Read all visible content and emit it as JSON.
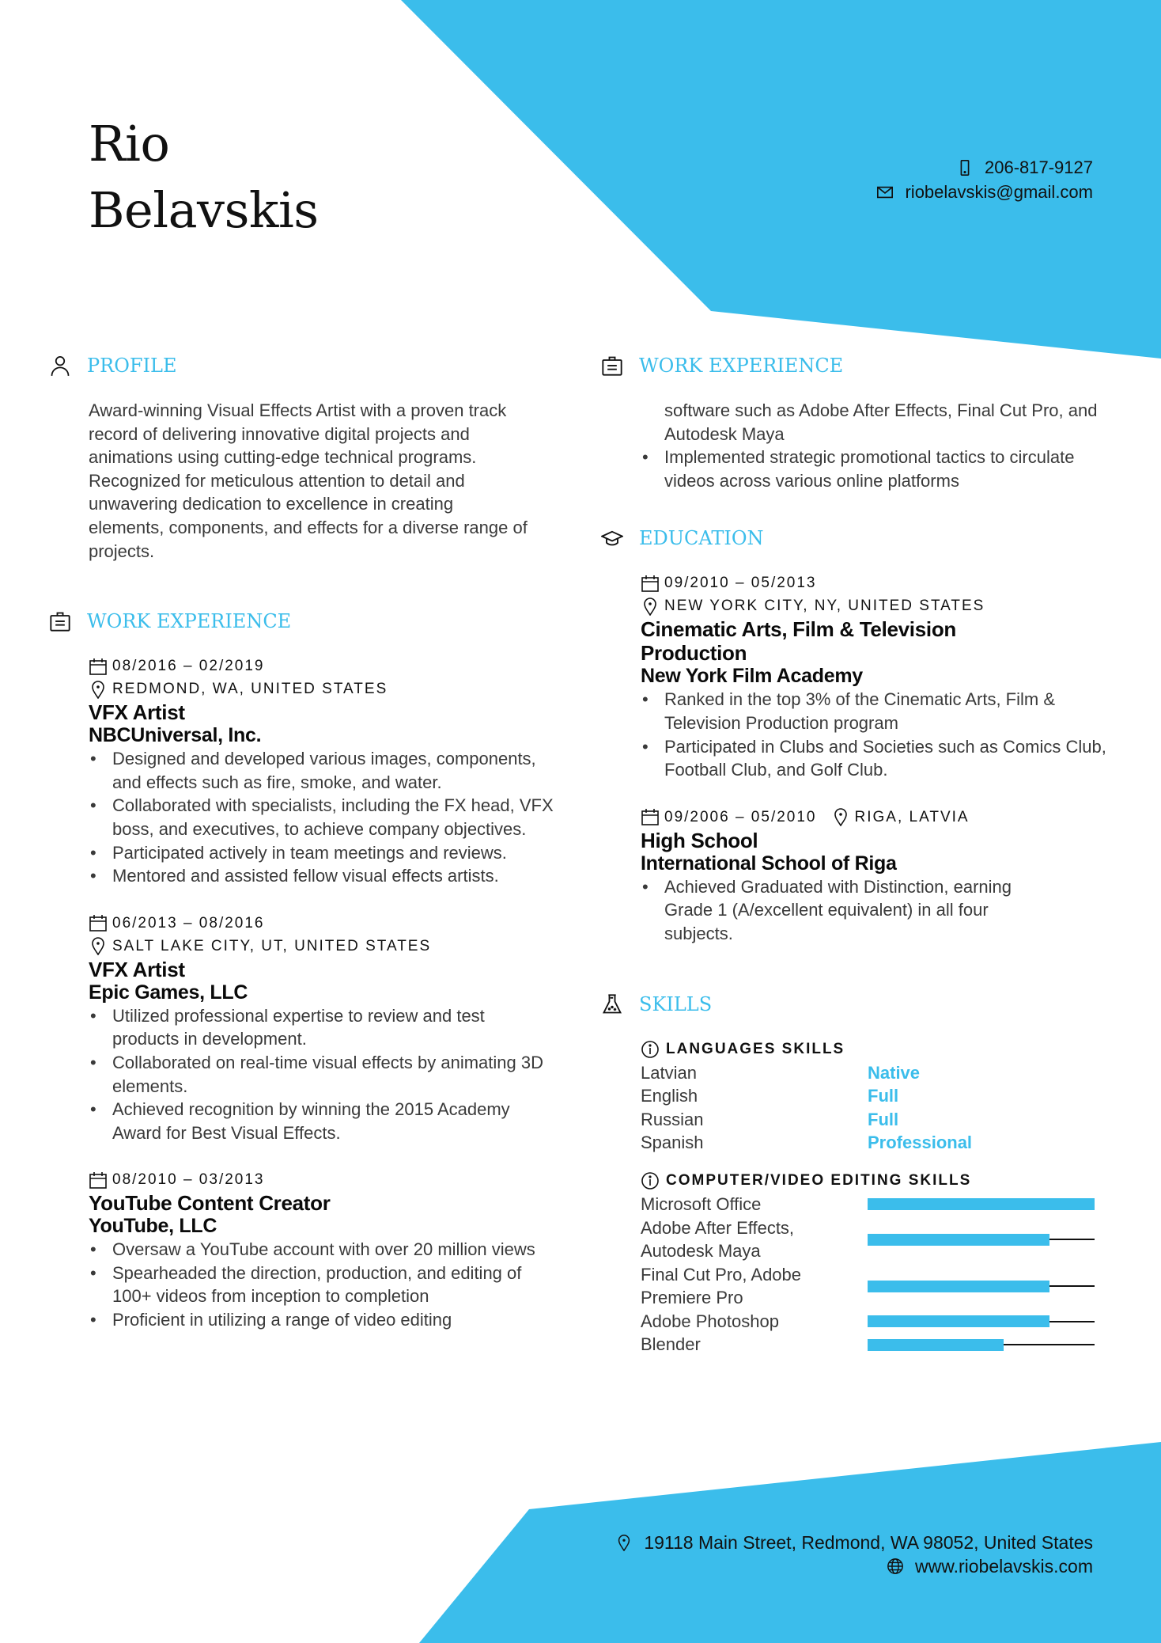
{
  "theme": {
    "accent": "#3bbdeb",
    "text": "#333333",
    "heading": "#0a0a0a"
  },
  "header": {
    "first_name": "Rio",
    "last_name": "Belavskis",
    "phone": "206-817-9127",
    "email": "riobelavskis@gmail.com"
  },
  "profile": {
    "title": "PROFILE",
    "icon": "user-icon",
    "text": "Award-winning Visual Effects Artist with a proven track record of delivering innovative digital projects and animations using cutting-edge technical programs. Recognized for meticulous attention to detail and unwavering dedication to excellence in creating elements, components, and effects for a diverse range of projects."
  },
  "work": {
    "title": "WORK EXPERIENCE",
    "icon": "briefcase-icon",
    "jobs": [
      {
        "dates": "08/2016 – 02/2019",
        "location": "REDMOND, WA, UNITED STATES",
        "title": "VFX Artist",
        "company": "NBCUniversal, Inc.",
        "bullets": [
          "Designed and developed various images, components, and effects such as fire, smoke, and water.",
          "Collaborated with specialists, including the FX head, VFX boss, and executives, to achieve company objectives.",
          "Participated actively in team meetings and reviews.",
          "Mentored and assisted fellow visual effects artists."
        ]
      },
      {
        "dates": "06/2013 – 08/2016",
        "location": "SALT LAKE CITY, UT, UNITED STATES",
        "title": "VFX Artist",
        "company": "Epic Games, LLC",
        "bullets": [
          "Utilized professional expertise to review and test products in development.",
          "Collaborated on real-time visual effects by animating 3D elements.",
          "Achieved recognition by winning the 2015 Academy Award for Best Visual Effects."
        ]
      },
      {
        "dates": "08/2010 – 03/2013",
        "title": "YouTube Content Creator",
        "company": "YouTube, LLC",
        "bullets": [
          "Oversaw a YouTube account with over 20 million views",
          "Spearheaded the direction, production, and editing of 100+ videos from inception to completion",
          "Proficient in utilizing a range of video editing"
        ],
        "continued_text": "software such as Adobe After Effects, Final Cut Pro, and Autodesk Maya",
        "continued_bullets": [
          "Implemented strategic promotional tactics to circulate videos across various online platforms"
        ]
      }
    ]
  },
  "education": {
    "title": "EDUCATION",
    "icon": "graduation-cap-icon",
    "entries": [
      {
        "dates": "09/2010 – 05/2013",
        "location": "NEW YORK CITY, NY, UNITED STATES",
        "degree": "Cinematic Arts, Film & Television Production",
        "school": "New York Film Academy",
        "bullets": [
          "Ranked in the top 3% of the Cinematic Arts, Film & Television Production program",
          "Participated in Clubs and Societies such as Comics Club, Football Club, and Golf Club."
        ]
      },
      {
        "dates": "09/2006 – 05/2010",
        "location": "RIGA, LATVIA",
        "degree": "High School",
        "school": "International School of Riga",
        "bullets": [
          "Achieved Graduated with Distinction, earning Grade 1 (A/excellent equivalent) in all four subjects."
        ]
      }
    ]
  },
  "skills": {
    "title": "SKILLS",
    "icon": "flask-icon",
    "languages_title": "LANGUAGES SKILLS",
    "languages": [
      {
        "name": "Latvian",
        "level": "Native"
      },
      {
        "name": "English",
        "level": "Full"
      },
      {
        "name": "Russian",
        "level": "Full"
      },
      {
        "name": "Spanish",
        "level": "Professional"
      }
    ],
    "computer_title": "COMPUTER/VIDEO EDITING SKILLS",
    "computer": [
      {
        "name": "Microsoft Office",
        "level_percent": 100
      },
      {
        "name": "Adobe After Effects, Autodesk Maya",
        "level_percent": 80
      },
      {
        "name": "Final Cut Pro, Adobe Premiere Pro",
        "level_percent": 80
      },
      {
        "name": "Adobe Photoshop",
        "level_percent": 80
      },
      {
        "name": "Blender",
        "level_percent": 60
      }
    ]
  },
  "footer": {
    "address": "19118 Main Street, Redmond, WA 98052, United States",
    "website": "www.riobelavskis.com"
  }
}
